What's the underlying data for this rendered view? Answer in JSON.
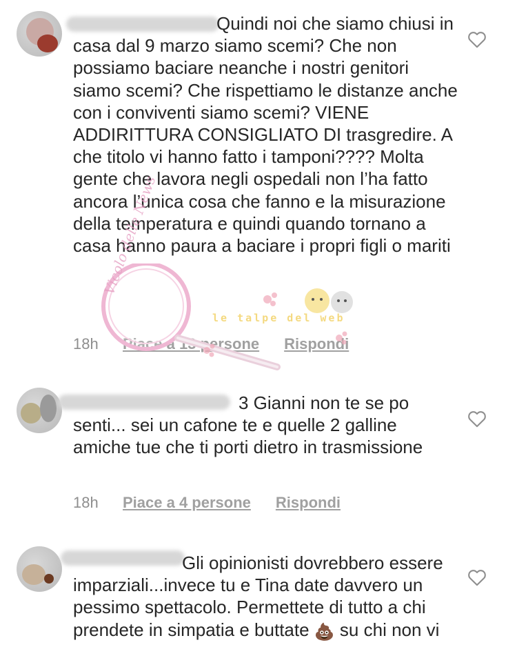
{
  "comments": [
    {
      "text": "Quindi noi che siamo chiusi in casa dal 9 marzo siamo scemi? Che non possiamo baciare neanche i nostri genitori siamo scemi? Che rispettiamo le distanze anche con i conviventi siamo scemi? VIENE ADDIRITTURA CONSIGLIATO DI trasgredire. A che titolo vi hanno fatto i tamponi???? Molta gente che lavora negli ospedali non l’ha fatto ancora  l’unica cosa che fanno e la misurazione della temperatura e quindi quando tornano a casa hanno paura a baciare i propri figli o mariti",
      "time": "18h",
      "likes": "Piace a 13 persone",
      "reply": "Rispondi"
    },
    {
      "text_prefix": "3 Gianni non te se po senti... sei un cafone te e quelle 2 galline amiche tue che ti porti dietro in trasmissione",
      "time": "18h",
      "likes": "Piace a 4 persone",
      "reply": "Rispondi"
    },
    {
      "text_a": "Gli opinionisti dovrebbero essere imparziali...invece tu e Tina date davvero un pessimo spettacolo. Permettete di tutto a chi prendete in simpatia e buttate",
      "emoji": "💩",
      "text_b": "su chi non vi"
    }
  ],
  "watermark": {
    "main": "Vicolo delle News",
    "tagline": "le talpe del web"
  },
  "icons": {
    "like": "heart-outline-icon",
    "emoji": "pile-of-poo-emoji"
  },
  "colors": {
    "text": "#262626",
    "meta": "#8e8e8e",
    "watermark_pink": "#e8a6c8",
    "watermark_yellow": "#f3d36b"
  }
}
